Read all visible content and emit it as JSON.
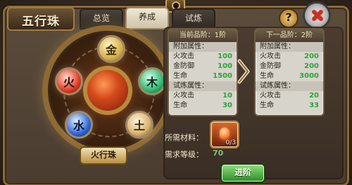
{
  "window": {
    "title": "五行珠"
  },
  "tabs": [
    {
      "label": "总览",
      "active": false
    },
    {
      "label": "养成",
      "active": true
    },
    {
      "label": "试炼",
      "active": false
    }
  ],
  "buttons": {
    "help_label": "?",
    "advance_label": "进阶"
  },
  "wheel": {
    "bottom_label": "火行珠",
    "orbs": {
      "jin": "金",
      "mu": "木",
      "huo": "火",
      "shui": "水",
      "tu": "土"
    }
  },
  "current": {
    "header": "当前品阶：1阶",
    "attr_title": "附加属性：",
    "attrs": [
      {
        "name": "火攻击",
        "value": "100"
      },
      {
        "name": "金防御",
        "value": "100"
      },
      {
        "name": "生命",
        "value": "1500"
      }
    ],
    "trial_title": "试炼属性：",
    "trial_attrs": [
      {
        "name": "火攻击",
        "value": "10"
      },
      {
        "name": "生命",
        "value": "30"
      }
    ]
  },
  "next": {
    "header": "下一品阶：2阶",
    "attr_title": "附加属性：",
    "attrs": [
      {
        "name": "火攻击",
        "value": "200"
      },
      {
        "name": "金防御",
        "value": "200"
      },
      {
        "name": "生命",
        "value": "3000"
      }
    ],
    "trial_title": "试炼属性：",
    "trial_attrs": [
      {
        "name": "火攻击",
        "value": "20"
      },
      {
        "name": "生命",
        "value": "33"
      }
    ]
  },
  "requirements": {
    "materials_label": "所需材料：",
    "material_qty": "0/3",
    "level_label": "需求等级：",
    "level_value": "70"
  },
  "colors": {
    "accent_green": "#2aa43b",
    "frame_gold": "#8b6a3a"
  },
  "icons": {
    "camera": "camera-icon",
    "help": "question-mark-icon",
    "close": "close-icon",
    "arrow": "chevron-right-icon",
    "material": "fire-orb-material-icon"
  }
}
